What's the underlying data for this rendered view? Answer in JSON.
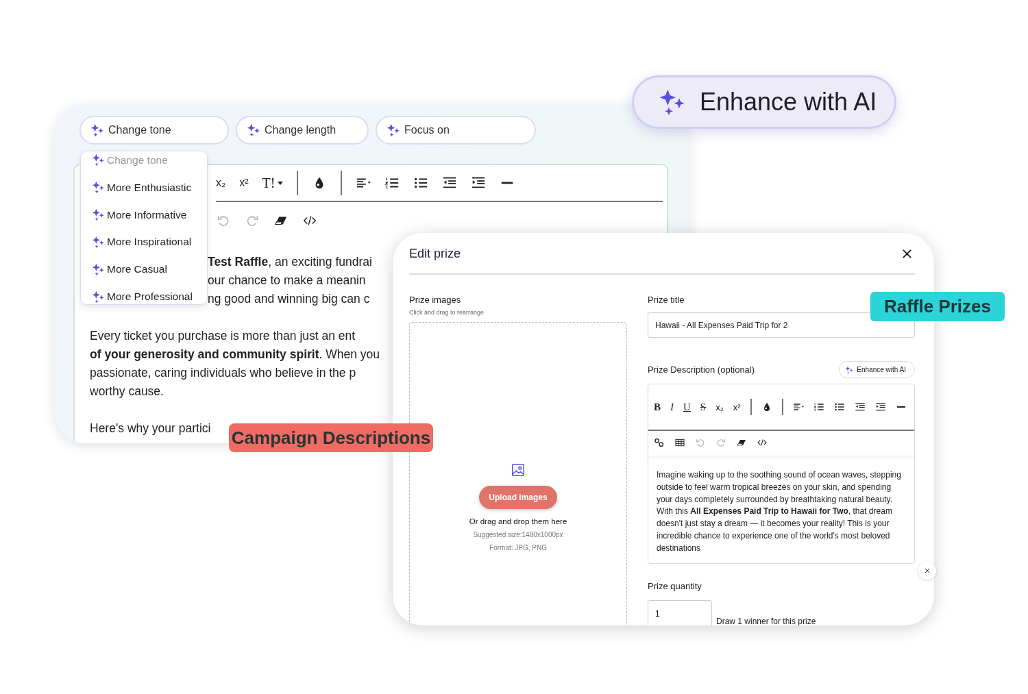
{
  "ai_badge": {
    "label": "Enhance with AI"
  },
  "campaign_editor": {
    "ai_chips": [
      {
        "label": "Change tone"
      },
      {
        "label": "Change length"
      },
      {
        "label": "Focus on"
      }
    ],
    "toolbar_rows": [
      [
        {
          "kind": "glyph",
          "label": "x₂"
        },
        {
          "kind": "glyph",
          "label": "x²"
        },
        {
          "kind": "glyph_menu",
          "label": "T!"
        },
        {
          "kind": "sep"
        },
        {
          "kind": "color"
        },
        {
          "kind": "sep"
        },
        {
          "kind": "align"
        },
        {
          "kind": "ordered_list"
        },
        {
          "kind": "bullet_list"
        },
        {
          "kind": "outdent"
        },
        {
          "kind": "indent"
        },
        {
          "kind": "rule"
        }
      ],
      [
        {
          "kind": "undo"
        },
        {
          "kind": "redo"
        },
        {
          "kind": "eraser"
        },
        {
          "kind": "code"
        }
      ]
    ],
    "text_blocks": [
      {
        "kind": "covered",
        "lines": [
          "**Test Raffle**, an exciting fundrai",
          "our chance to make a meanin",
          "ng good and winning big can c"
        ]
      },
      {
        "kind": "plain",
        "lines": [
          "Every ticket you purchase is more than just an ent",
          "**of your generosity and community spirit**. When you",
          "passionate, caring individuals who believe in the p",
          "worthy cause."
        ]
      },
      {
        "kind": "plain",
        "lines": [
          "Here's why your partici"
        ]
      }
    ],
    "tone_menu": {
      "header": "Change tone",
      "items": [
        "More Enthusiastic",
        "More Informative",
        "More Inspirational",
        "More Casual",
        "More Professional"
      ]
    }
  },
  "campaign_label": "Campaign Descriptions",
  "edit_prize": {
    "title": "Edit prize",
    "images": {
      "label": "Prize images",
      "hint": "Click and drag to rearrange",
      "upload_button": "Upload images",
      "drop_text": "Or drag and drop them here",
      "size_hint": "Suggested size:1480x1000px",
      "format_hint": "Format: JPG, PNG"
    },
    "prize_title": {
      "label": "Prize title",
      "value": "Hawaii - All Expenses Paid Trip for 2"
    },
    "description": {
      "label": "Prize Description (optional)",
      "enhance_button": "Enhance with AI",
      "toolbar_rows": [
        [
          {
            "kind": "glyph_serif_bold",
            "label": "B"
          },
          {
            "kind": "glyph_serif_italic",
            "label": "I"
          },
          {
            "kind": "glyph_serif_underline",
            "label": "U"
          },
          {
            "kind": "glyph_serif_strike",
            "label": "S"
          },
          {
            "kind": "glyph",
            "label": "x₂"
          },
          {
            "kind": "glyph",
            "label": "x²"
          },
          {
            "kind": "sep"
          },
          {
            "kind": "color"
          },
          {
            "kind": "sep"
          },
          {
            "kind": "align"
          },
          {
            "kind": "ordered_list"
          },
          {
            "kind": "bullet_list"
          },
          {
            "kind": "outdent"
          },
          {
            "kind": "indent"
          },
          {
            "kind": "rule"
          }
        ],
        [
          {
            "kind": "link"
          },
          {
            "kind": "table"
          },
          {
            "kind": "undo"
          },
          {
            "kind": "redo"
          },
          {
            "kind": "eraser"
          },
          {
            "kind": "code"
          }
        ]
      ],
      "text": "Imagine waking up to the soothing sound of ocean waves, stepping outside to feel warm tropical breezes on your skin, and spending your days completely surrounded by breathtaking natural beauty. With this **All Expenses Paid Trip to Hawaii for Two**, that dream doesn't just stay a dream — it becomes your reality! This is your incredible chance to experience one of the world's most beloved destinations"
    },
    "quantity": {
      "label": "Prize quantity",
      "value": "1",
      "note": "Draw 1 winner for this prize"
    }
  },
  "raffle_label": "Raffle Prizes"
}
